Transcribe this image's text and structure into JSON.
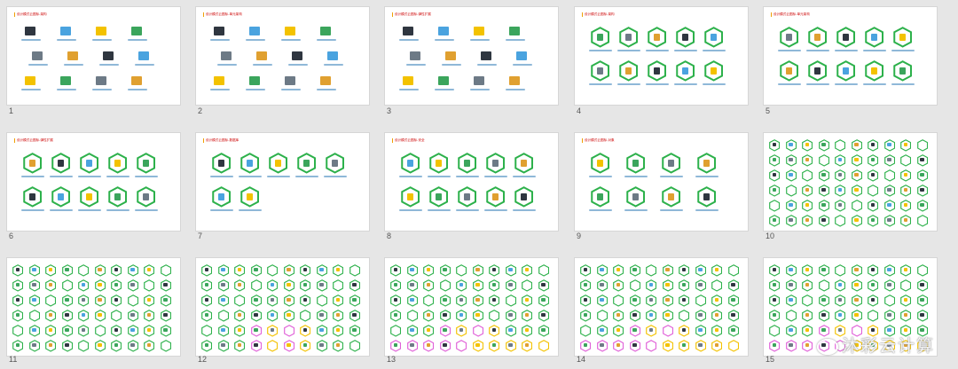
{
  "slides": [
    {
      "n": "1",
      "title": "设计模式云图标-架构"
    },
    {
      "n": "2",
      "title": "设计模式云图标-单元架构"
    },
    {
      "n": "3",
      "title": "设计模式云图标-弹性扩展"
    },
    {
      "n": "4",
      "title": "设计模式云图标-架构"
    },
    {
      "n": "5",
      "title": "设计模式云图标-单元架构"
    },
    {
      "n": "6",
      "title": "设计模式云图标-弹性扩展"
    },
    {
      "n": "7",
      "title": "设计模式云图标-数据库"
    },
    {
      "n": "8",
      "title": "设计模式云图标-安全"
    },
    {
      "n": "9",
      "title": "设计模式云图标-对象"
    },
    {
      "n": "10",
      "title": ""
    },
    {
      "n": "11",
      "title": ""
    },
    {
      "n": "12",
      "title": ""
    },
    {
      "n": "13",
      "title": ""
    },
    {
      "n": "14",
      "title": ""
    },
    {
      "n": "15",
      "title": ""
    }
  ],
  "watermark": "沐彩云计算",
  "colors": {
    "hex_green": "#2db14b",
    "pink": "#e05fd8",
    "yellow": "#f3c200",
    "icon_dark": "#2f3640",
    "icon_blue": "#4aa3df"
  }
}
